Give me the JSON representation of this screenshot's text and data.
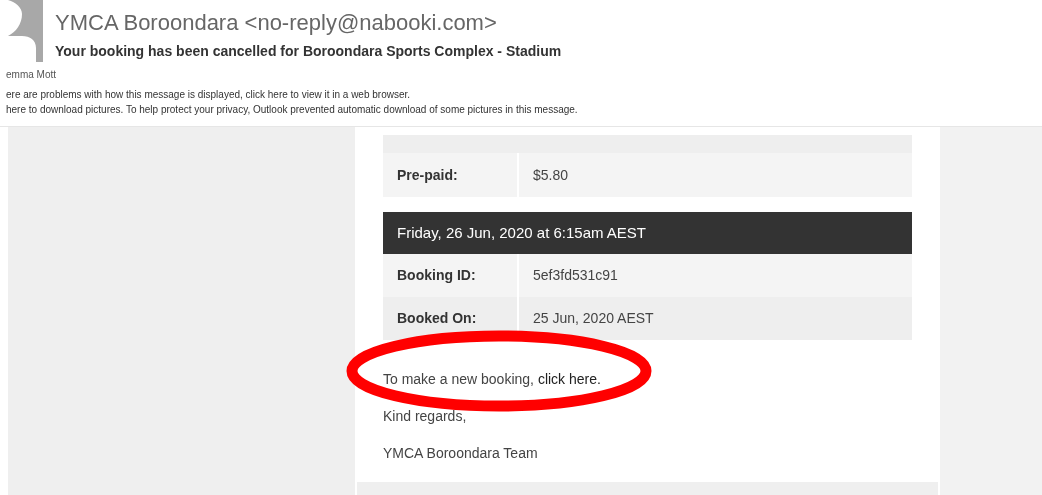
{
  "header": {
    "sender": "YMCA Boroondara <no-reply@nabooki.com>",
    "subject": "Your booking has been cancelled for Boroondara Sports Complex - Stadium",
    "recipient": "emma Mott",
    "notices": [
      "ere are problems with how this message is displayed, click here to view it in a web browser.",
      "here to download pictures. To help protect your privacy, Outlook prevented automatic download of some pictures in this message."
    ]
  },
  "details_top": [
    {
      "label": "Pre-paid:",
      "value": "$5.80"
    }
  ],
  "booking": {
    "title": "Friday, 26 Jun, 2020 at 6:15am AEST",
    "rows": [
      {
        "label": "Booking ID:",
        "value": "5ef3fd531c91"
      },
      {
        "label": "Booked On:",
        "value": "25 Jun, 2020 AEST"
      }
    ]
  },
  "new_booking": {
    "text": "To make a new booking, ",
    "link": "click here."
  },
  "sign_off": [
    "Kind regards,",
    "YMCA Boroondara Team"
  ]
}
